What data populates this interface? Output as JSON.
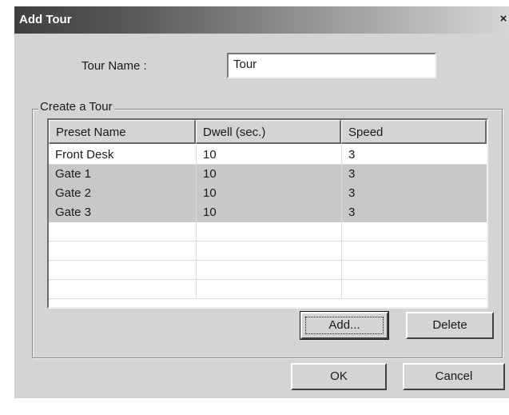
{
  "dialog": {
    "title": "Add Tour",
    "close_glyph": "×"
  },
  "tour_name": {
    "label": "Tour Name :",
    "value": "Tour"
  },
  "group": {
    "legend": "Create a Tour"
  },
  "table": {
    "columns": [
      "Preset Name",
      "Dwell (sec.)",
      "Speed"
    ],
    "rows": [
      {
        "preset": "Front Desk",
        "dwell": "10",
        "speed": "3",
        "selected": false
      },
      {
        "preset": "Gate 1",
        "dwell": "10",
        "speed": "3",
        "selected": true
      },
      {
        "preset": "Gate 2",
        "dwell": "10",
        "speed": "3",
        "selected": true
      },
      {
        "preset": "Gate 3",
        "dwell": "10",
        "speed": "3",
        "selected": true
      },
      {
        "preset": "",
        "dwell": "",
        "speed": "",
        "selected": false
      },
      {
        "preset": "",
        "dwell": "",
        "speed": "",
        "selected": false
      },
      {
        "preset": "",
        "dwell": "",
        "speed": "",
        "selected": false
      },
      {
        "preset": "",
        "dwell": "",
        "speed": "",
        "selected": false
      }
    ]
  },
  "buttons": {
    "add": "Add...",
    "delete": "Delete",
    "ok": "OK",
    "cancel": "Cancel"
  }
}
